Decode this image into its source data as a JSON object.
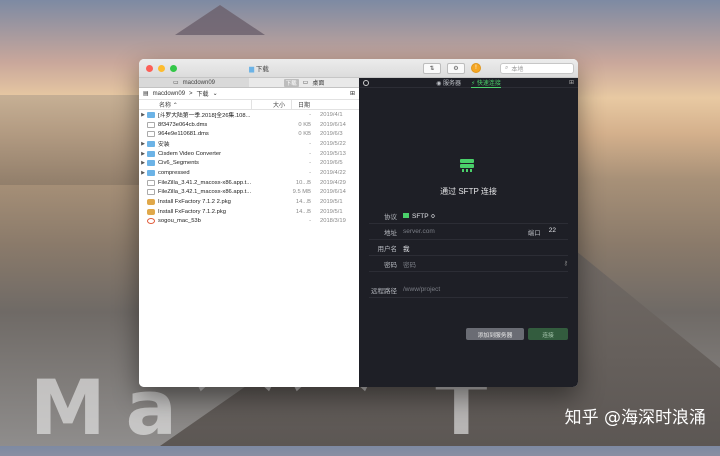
{
  "window": {
    "title": "下载"
  },
  "toolbar": {
    "search_placeholder": "本地"
  },
  "left_tabs": [
    {
      "label": "macdown09"
    },
    {
      "tag": "下载",
      "label": "桌面"
    }
  ],
  "path": {
    "root": "macdown09",
    "sep": ">",
    "current": "下载"
  },
  "columns": {
    "name": "名称",
    "size": "大小",
    "date": "日期"
  },
  "files": [
    {
      "name": "[斗罗大陆第一季.2018]全26集.108...",
      "size": "-",
      "date": "2019/4/1",
      "type": "folder-closed"
    },
    {
      "name": "8f3473e064cb.dms",
      "size": "0 KB",
      "date": "2019/6/14",
      "type": "file"
    },
    {
      "name": "964e9e110681.dms",
      "size": "0 KB",
      "date": "2019/6/3",
      "type": "file"
    },
    {
      "name": "安装",
      "size": "-",
      "date": "2019/5/22",
      "type": "folder"
    },
    {
      "name": "Cisdem Video Converter",
      "size": "-",
      "date": "2019/5/13",
      "type": "folder"
    },
    {
      "name": "Civ6_Segments",
      "size": "-",
      "date": "2019/6/5",
      "type": "folder"
    },
    {
      "name": "compressed",
      "size": "-",
      "date": "2019/4/22",
      "type": "folder"
    },
    {
      "name": "FileZilla_3.41.2_macosx-x86.app.t...",
      "size": "10...B",
      "date": "2019/4/29",
      "type": "file"
    },
    {
      "name": "FileZilla_3.42.1_macosx-x86.app.t...",
      "size": "9.5 MB",
      "date": "2019/6/14",
      "type": "file"
    },
    {
      "name": "Install FxFactory 7.1.2 2.pkg",
      "size": "14...B",
      "date": "2019/5/1",
      "type": "pkg"
    },
    {
      "name": "Install FxFactory 7.1.2.pkg",
      "size": "14...B",
      "date": "2019/5/1",
      "type": "pkg"
    },
    {
      "name": "sogou_mac_53b",
      "size": "-",
      "date": "2018/3/19",
      "type": "sogou"
    }
  ],
  "right_tabs": {
    "servers": "服务器",
    "quick": "⚡ 快速连接"
  },
  "connect": {
    "title": "通过 SFTP 连接",
    "protocol_label": "协议",
    "protocol_value": "SFTP ≎",
    "address_label": "地址",
    "address_placeholder": "server.com",
    "port_label": "端口",
    "port_value": "22",
    "user_label": "用户名",
    "user_value": "我",
    "password_label": "密码",
    "password_value": "密码",
    "remote_label": "远程路径",
    "remote_placeholder": "/www/project",
    "add_button": "添加到服务器",
    "connect_button": "连接"
  },
  "watermark": "知乎 @海深时浪涌"
}
